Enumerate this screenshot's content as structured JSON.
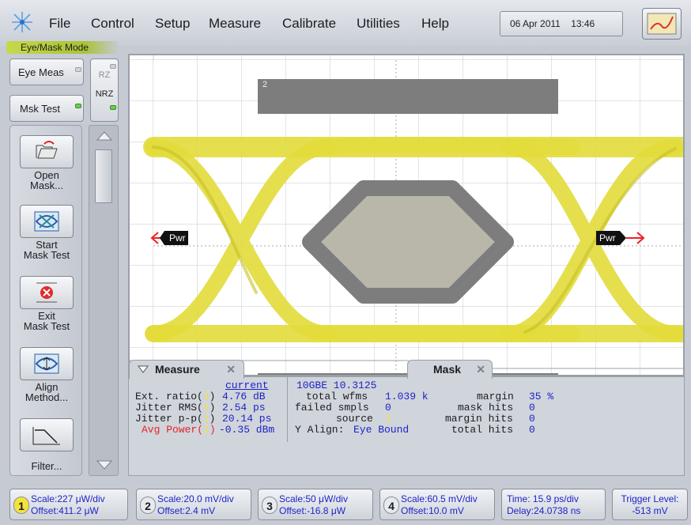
{
  "menubar": {
    "items": [
      "File",
      "Control",
      "Setup",
      "Measure",
      "Calibrate",
      "Utilities",
      "Help"
    ],
    "date": "06 Apr 2011",
    "time": "13:46"
  },
  "mode_label": "Eye/Mask Mode",
  "side": {
    "eye_meas": "Eye Meas",
    "msk_test": "Msk Test",
    "rz": "RZ",
    "nrz": "NRZ"
  },
  "tools": [
    {
      "line1": "Open",
      "line2": "Mask..."
    },
    {
      "line1": "Start",
      "line2": "Mask Test"
    },
    {
      "line1": "Exit",
      "line2": "Mask Test"
    },
    {
      "line1": "Align",
      "line2": "Method..."
    },
    {
      "line1": "Filter...",
      "line2": ""
    }
  ],
  "screen": {
    "mask_region_label": "2",
    "marker_left": "Pwr",
    "marker_right": "Pwr",
    "trace_color": "#e2dc3a",
    "mask_color": "#7d7d7d"
  },
  "measure_tab": "Measure",
  "mask_tab": "Mask",
  "measure": {
    "header": "current",
    "rows": [
      {
        "label": "Ext. ratio(",
        "ch": "1",
        "close": ")",
        "value": "4.76 dB"
      },
      {
        "label": "Jitter RMS(",
        "ch": "1",
        "close": ")",
        "value": "2.54 ps"
      },
      {
        "label": "Jitter p-p(",
        "ch": "1",
        "close": ")",
        "value": "20.14 ps"
      },
      {
        "label": "Avg Power(",
        "ch": "1",
        "close": ")",
        "value": "-0.35 dBm"
      }
    ]
  },
  "mask": {
    "name": "10GBE 10.3125",
    "total_wfms_label": "total wfms",
    "total_wfms": "1.039 k",
    "failed_smpls_label": "failed smpls",
    "failed_smpls": "0",
    "source_label": "source",
    "source": "1",
    "y_align_label": "Y Align:",
    "y_align": "Eye Bound",
    "margin_label": "margin",
    "margin": "35 %",
    "mask_hits_label": "mask hits",
    "mask_hits": "0",
    "margin_hits_label": "margin hits",
    "margin_hits": "0",
    "total_hits_label": "total hits",
    "total_hits": "0"
  },
  "status": [
    {
      "ch": "1",
      "scale": "Scale:227 μW/div",
      "offset": "Offset:411.2 μW"
    },
    {
      "ch": "2",
      "scale": "Scale:20.0 mV/div",
      "offset": "Offset:2.4 mV"
    },
    {
      "ch": "3",
      "scale": "Scale:50 μW/div",
      "offset": "Offset:-16.8 μW"
    },
    {
      "ch": "4",
      "scale": "Scale:60.5 mV/div",
      "offset": "Offset:10.0 mV"
    }
  ],
  "timebase": {
    "time": "Time: 15.9 ps/div",
    "delay": "Delay:24.0738 ns"
  },
  "trigger": {
    "label": "Trigger Level:",
    "value": "-513 mV"
  }
}
